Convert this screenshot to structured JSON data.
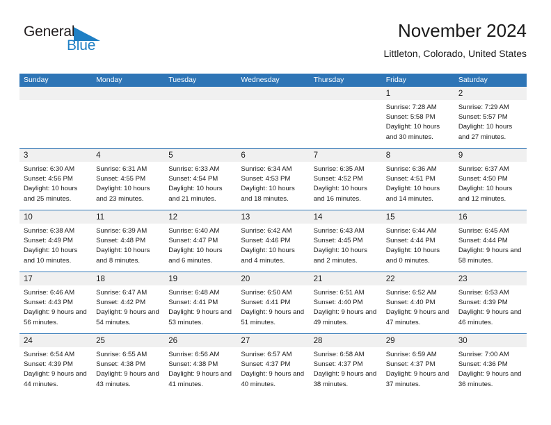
{
  "brand": {
    "name_part1": "General",
    "name_part2": "Blue",
    "logo_icon": "triangle-flag-icon",
    "accent_color": "#1f7fc4"
  },
  "header": {
    "title": "November 2024",
    "location": "Littleton, Colorado, United States"
  },
  "colors": {
    "header_row_bg": "#2e75b6",
    "daynum_band_bg": "#f0f0f0",
    "grid_line": "#2e75b6",
    "text": "#1a1a1a"
  },
  "calendar": {
    "weekday_headers": [
      "Sunday",
      "Monday",
      "Tuesday",
      "Wednesday",
      "Thursday",
      "Friday",
      "Saturday"
    ],
    "weeks": [
      [
        {
          "day": "",
          "empty": true
        },
        {
          "day": "",
          "empty": true
        },
        {
          "day": "",
          "empty": true
        },
        {
          "day": "",
          "empty": true
        },
        {
          "day": "",
          "empty": true
        },
        {
          "day": "1",
          "sunrise": "Sunrise: 7:28 AM",
          "sunset": "Sunset: 5:58 PM",
          "daylight": "Daylight: 10 hours and 30 minutes."
        },
        {
          "day": "2",
          "sunrise": "Sunrise: 7:29 AM",
          "sunset": "Sunset: 5:57 PM",
          "daylight": "Daylight: 10 hours and 27 minutes."
        }
      ],
      [
        {
          "day": "3",
          "sunrise": "Sunrise: 6:30 AM",
          "sunset": "Sunset: 4:56 PM",
          "daylight": "Daylight: 10 hours and 25 minutes."
        },
        {
          "day": "4",
          "sunrise": "Sunrise: 6:31 AM",
          "sunset": "Sunset: 4:55 PM",
          "daylight": "Daylight: 10 hours and 23 minutes."
        },
        {
          "day": "5",
          "sunrise": "Sunrise: 6:33 AM",
          "sunset": "Sunset: 4:54 PM",
          "daylight": "Daylight: 10 hours and 21 minutes."
        },
        {
          "day": "6",
          "sunrise": "Sunrise: 6:34 AM",
          "sunset": "Sunset: 4:53 PM",
          "daylight": "Daylight: 10 hours and 18 minutes."
        },
        {
          "day": "7",
          "sunrise": "Sunrise: 6:35 AM",
          "sunset": "Sunset: 4:52 PM",
          "daylight": "Daylight: 10 hours and 16 minutes."
        },
        {
          "day": "8",
          "sunrise": "Sunrise: 6:36 AM",
          "sunset": "Sunset: 4:51 PM",
          "daylight": "Daylight: 10 hours and 14 minutes."
        },
        {
          "day": "9",
          "sunrise": "Sunrise: 6:37 AM",
          "sunset": "Sunset: 4:50 PM",
          "daylight": "Daylight: 10 hours and 12 minutes."
        }
      ],
      [
        {
          "day": "10",
          "sunrise": "Sunrise: 6:38 AM",
          "sunset": "Sunset: 4:49 PM",
          "daylight": "Daylight: 10 hours and 10 minutes."
        },
        {
          "day": "11",
          "sunrise": "Sunrise: 6:39 AM",
          "sunset": "Sunset: 4:48 PM",
          "daylight": "Daylight: 10 hours and 8 minutes."
        },
        {
          "day": "12",
          "sunrise": "Sunrise: 6:40 AM",
          "sunset": "Sunset: 4:47 PM",
          "daylight": "Daylight: 10 hours and 6 minutes."
        },
        {
          "day": "13",
          "sunrise": "Sunrise: 6:42 AM",
          "sunset": "Sunset: 4:46 PM",
          "daylight": "Daylight: 10 hours and 4 minutes."
        },
        {
          "day": "14",
          "sunrise": "Sunrise: 6:43 AM",
          "sunset": "Sunset: 4:45 PM",
          "daylight": "Daylight: 10 hours and 2 minutes."
        },
        {
          "day": "15",
          "sunrise": "Sunrise: 6:44 AM",
          "sunset": "Sunset: 4:44 PM",
          "daylight": "Daylight: 10 hours and 0 minutes."
        },
        {
          "day": "16",
          "sunrise": "Sunrise: 6:45 AM",
          "sunset": "Sunset: 4:44 PM",
          "daylight": "Daylight: 9 hours and 58 minutes."
        }
      ],
      [
        {
          "day": "17",
          "sunrise": "Sunrise: 6:46 AM",
          "sunset": "Sunset: 4:43 PM",
          "daylight": "Daylight: 9 hours and 56 minutes."
        },
        {
          "day": "18",
          "sunrise": "Sunrise: 6:47 AM",
          "sunset": "Sunset: 4:42 PM",
          "daylight": "Daylight: 9 hours and 54 minutes."
        },
        {
          "day": "19",
          "sunrise": "Sunrise: 6:48 AM",
          "sunset": "Sunset: 4:41 PM",
          "daylight": "Daylight: 9 hours and 53 minutes."
        },
        {
          "day": "20",
          "sunrise": "Sunrise: 6:50 AM",
          "sunset": "Sunset: 4:41 PM",
          "daylight": "Daylight: 9 hours and 51 minutes."
        },
        {
          "day": "21",
          "sunrise": "Sunrise: 6:51 AM",
          "sunset": "Sunset: 4:40 PM",
          "daylight": "Daylight: 9 hours and 49 minutes."
        },
        {
          "day": "22",
          "sunrise": "Sunrise: 6:52 AM",
          "sunset": "Sunset: 4:40 PM",
          "daylight": "Daylight: 9 hours and 47 minutes."
        },
        {
          "day": "23",
          "sunrise": "Sunrise: 6:53 AM",
          "sunset": "Sunset: 4:39 PM",
          "daylight": "Daylight: 9 hours and 46 minutes."
        }
      ],
      [
        {
          "day": "24",
          "sunrise": "Sunrise: 6:54 AM",
          "sunset": "Sunset: 4:39 PM",
          "daylight": "Daylight: 9 hours and 44 minutes."
        },
        {
          "day": "25",
          "sunrise": "Sunrise: 6:55 AM",
          "sunset": "Sunset: 4:38 PM",
          "daylight": "Daylight: 9 hours and 43 minutes."
        },
        {
          "day": "26",
          "sunrise": "Sunrise: 6:56 AM",
          "sunset": "Sunset: 4:38 PM",
          "daylight": "Daylight: 9 hours and 41 minutes."
        },
        {
          "day": "27",
          "sunrise": "Sunrise: 6:57 AM",
          "sunset": "Sunset: 4:37 PM",
          "daylight": "Daylight: 9 hours and 40 minutes."
        },
        {
          "day": "28",
          "sunrise": "Sunrise: 6:58 AM",
          "sunset": "Sunset: 4:37 PM",
          "daylight": "Daylight: 9 hours and 38 minutes."
        },
        {
          "day": "29",
          "sunrise": "Sunrise: 6:59 AM",
          "sunset": "Sunset: 4:37 PM",
          "daylight": "Daylight: 9 hours and 37 minutes."
        },
        {
          "day": "30",
          "sunrise": "Sunrise: 7:00 AM",
          "sunset": "Sunset: 4:36 PM",
          "daylight": "Daylight: 9 hours and 36 minutes."
        }
      ]
    ]
  }
}
